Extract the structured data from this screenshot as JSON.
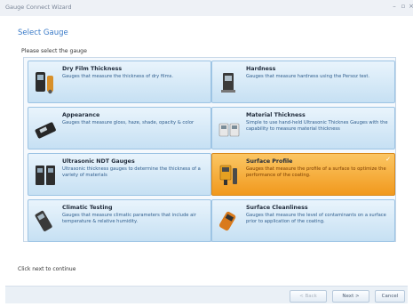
{
  "window": {
    "title": "Gauge Connect Wizard",
    "minimize_glyph": "–",
    "maximize_glyph": "▫",
    "close_glyph": "×"
  },
  "page": {
    "heading": "Select Gauge",
    "prompt": "Please select the gauge",
    "footer_text": "Click next to continue"
  },
  "gauges": [
    {
      "title": "Dry Film Thickness",
      "desc": "Gauges that measure the thickness of dry films.",
      "icon": "dry-film-gauge-icon",
      "selected": false
    },
    {
      "title": "Hardness",
      "desc": "Gauges that measure hardness using the Persoz test.",
      "icon": "hardness-gauge-icon",
      "selected": false
    },
    {
      "title": "Appearance",
      "desc": "Gauges that measure gloss, haze, shade, opacity & color",
      "icon": "appearance-gauge-icon",
      "selected": false
    },
    {
      "title": "Material Thickness",
      "desc": "Simple to use hand-held Ultrasonic Thicknes Gauges with the capability to measure material thickness",
      "icon": "material-thickness-gauge-icon",
      "selected": false
    },
    {
      "title": "Ultrasonic NDT Gauges",
      "desc": "Ultrasonic thickness gauges to determine the thickness of a variety of materials",
      "icon": "ultrasonic-gauge-icon",
      "selected": false
    },
    {
      "title": "Surface Profile",
      "desc": "Gauges that measure the profile of a surface to optimize the performance of the coating.",
      "icon": "surface-profile-gauge-icon",
      "selected": true
    },
    {
      "title": "Climatic Testing",
      "desc": "Gauges that measure climatic parameters that include air temperature & relative humidity.",
      "icon": "climatic-gauge-icon",
      "selected": false
    },
    {
      "title": "Surface Cleanliness",
      "desc": "Gauges that measure the level of contaminants on a surface prior to application of the coating.",
      "icon": "cleanliness-gauge-icon",
      "selected": false
    }
  ],
  "selected_check_glyph": "✓",
  "buttons": {
    "back": "< Back",
    "next": "Next >",
    "cancel": "Cancel"
  },
  "colors": {
    "accent": "#3b7bc8",
    "tile_top": "#e9f4fc",
    "tile_bottom": "#c6e0f3",
    "selected_top": "#fbc664",
    "selected_bottom": "#f1991d"
  }
}
